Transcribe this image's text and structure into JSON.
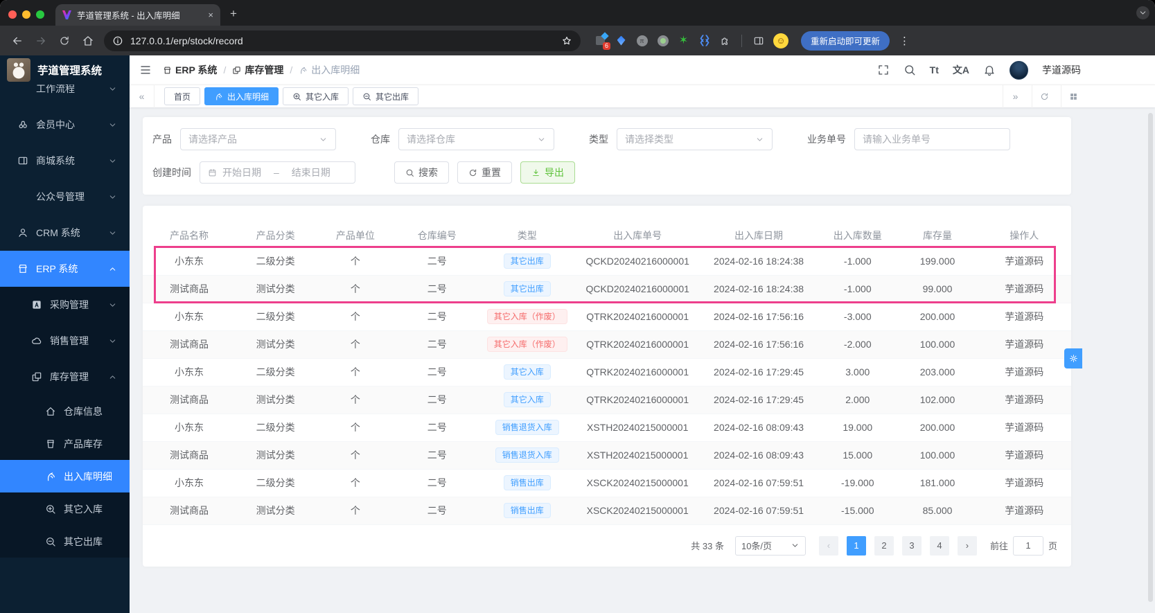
{
  "window": {
    "tab_title": "芋道管理系统 - 出入库明细",
    "url": "127.0.0.1/erp/stock/record",
    "update_button": "重新启动即可更新"
  },
  "glyphs": {
    "new_tab": "+",
    "close_tab": "×",
    "more": "⋮",
    "collapse": "«",
    "expand": "»",
    "prev": "‹",
    "next": "›",
    "crumb_sep": "/",
    "date_sep": "–",
    "font_icon": "Tt",
    "lang_icon": "文A",
    "smile": "☺"
  },
  "sidebar": {
    "logo_title": "芋道管理系统",
    "menu": [
      {
        "label": "工作流程"
      },
      {
        "label": "会员中心"
      },
      {
        "label": "商城系统"
      },
      {
        "label": "公众号管理"
      },
      {
        "label": "CRM 系统"
      },
      {
        "label": "ERP 系统"
      }
    ],
    "erp_submenu": [
      {
        "label": "采购管理"
      },
      {
        "label": "销售管理"
      },
      {
        "label": "库存管理"
      }
    ],
    "stock_submenu": [
      {
        "label": "仓库信息"
      },
      {
        "label": "产品库存"
      },
      {
        "label": "出入库明细"
      },
      {
        "label": "其它入库"
      },
      {
        "label": "其它出库"
      }
    ]
  },
  "header": {
    "breadcrumb": [
      {
        "label": "ERP 系统"
      },
      {
        "label": "库存管理"
      },
      {
        "label": "出入库明细"
      }
    ],
    "username": "芋道源码"
  },
  "tabbar": {
    "tabs": [
      {
        "label": "首页"
      },
      {
        "label": "出入库明细"
      },
      {
        "label": "其它入库"
      },
      {
        "label": "其它出库"
      }
    ]
  },
  "filters": {
    "product_label": "产品",
    "product_placeholder": "请选择产品",
    "warehouse_label": "仓库",
    "warehouse_placeholder": "请选择仓库",
    "type_label": "类型",
    "type_placeholder": "请选择类型",
    "bizno_label": "业务单号",
    "bizno_placeholder": "请输入业务单号",
    "created_label": "创建时间",
    "date_start": "开始日期",
    "date_end": "结束日期",
    "search_label": "搜索",
    "reset_label": "重置",
    "export_label": "导出"
  },
  "table": {
    "columns": [
      "产品名称",
      "产品分类",
      "产品单位",
      "仓库编号",
      "类型",
      "出入库单号",
      "出入库日期",
      "出入库数量",
      "库存量",
      "操作人"
    ],
    "rows": [
      {
        "product": "小东东",
        "category": "二级分类",
        "unit": "个",
        "warehouse": "二号",
        "type": "其它出库",
        "type_style": "info",
        "order_no": "QCKD20240216000001",
        "date": "2024-02-16 18:24:38",
        "qty": "-1.000",
        "stock": "199.000",
        "operator": "芋道源码"
      },
      {
        "product": "测试商品",
        "category": "测试分类",
        "unit": "个",
        "warehouse": "二号",
        "type": "其它出库",
        "type_style": "info",
        "order_no": "QCKD20240216000001",
        "date": "2024-02-16 18:24:38",
        "qty": "-1.000",
        "stock": "99.000",
        "operator": "芋道源码"
      },
      {
        "product": "小东东",
        "category": "二级分类",
        "unit": "个",
        "warehouse": "二号",
        "type": "其它入库（作废）",
        "type_style": "danger",
        "order_no": "QTRK20240216000001",
        "date": "2024-02-16 17:56:16",
        "qty": "-3.000",
        "stock": "200.000",
        "operator": "芋道源码"
      },
      {
        "product": "测试商品",
        "category": "测试分类",
        "unit": "个",
        "warehouse": "二号",
        "type": "其它入库（作废）",
        "type_style": "danger",
        "order_no": "QTRK20240216000001",
        "date": "2024-02-16 17:56:16",
        "qty": "-2.000",
        "stock": "100.000",
        "operator": "芋道源码"
      },
      {
        "product": "小东东",
        "category": "二级分类",
        "unit": "个",
        "warehouse": "二号",
        "type": "其它入库",
        "type_style": "info",
        "order_no": "QTRK20240216000001",
        "date": "2024-02-16 17:29:45",
        "qty": "3.000",
        "stock": "203.000",
        "operator": "芋道源码"
      },
      {
        "product": "测试商品",
        "category": "测试分类",
        "unit": "个",
        "warehouse": "二号",
        "type": "其它入库",
        "type_style": "info",
        "order_no": "QTRK20240216000001",
        "date": "2024-02-16 17:29:45",
        "qty": "2.000",
        "stock": "102.000",
        "operator": "芋道源码"
      },
      {
        "product": "小东东",
        "category": "二级分类",
        "unit": "个",
        "warehouse": "二号",
        "type": "销售退货入库",
        "type_style": "info",
        "order_no": "XSTH20240215000001",
        "date": "2024-02-16 08:09:43",
        "qty": "19.000",
        "stock": "200.000",
        "operator": "芋道源码"
      },
      {
        "product": "测试商品",
        "category": "测试分类",
        "unit": "个",
        "warehouse": "二号",
        "type": "销售退货入库",
        "type_style": "info",
        "order_no": "XSTH20240215000001",
        "date": "2024-02-16 08:09:43",
        "qty": "15.000",
        "stock": "100.000",
        "operator": "芋道源码"
      },
      {
        "product": "小东东",
        "category": "二级分类",
        "unit": "个",
        "warehouse": "二号",
        "type": "销售出库",
        "type_style": "info",
        "order_no": "XSCK20240215000001",
        "date": "2024-02-16 07:59:51",
        "qty": "-19.000",
        "stock": "181.000",
        "operator": "芋道源码"
      },
      {
        "product": "测试商品",
        "category": "测试分类",
        "unit": "个",
        "warehouse": "二号",
        "type": "销售出库",
        "type_style": "info",
        "order_no": "XSCK20240215000001",
        "date": "2024-02-16 07:59:51",
        "qty": "-15.000",
        "stock": "85.000",
        "operator": "芋道源码"
      }
    ]
  },
  "pagination": {
    "total": "共 33 条",
    "page_size": "10条/页",
    "pages": [
      "1",
      "2",
      "3",
      "4"
    ],
    "active_page": "1",
    "goto_label": "前往",
    "goto_value": "1",
    "goto_suffix": "页"
  },
  "colors": {
    "accent_blue": "#409eff",
    "sidebar_active_blue": "#3286ff",
    "highlight_pink": "#ed3f8c",
    "success_green": "#67c23a",
    "danger_red": "#f56c6c"
  }
}
